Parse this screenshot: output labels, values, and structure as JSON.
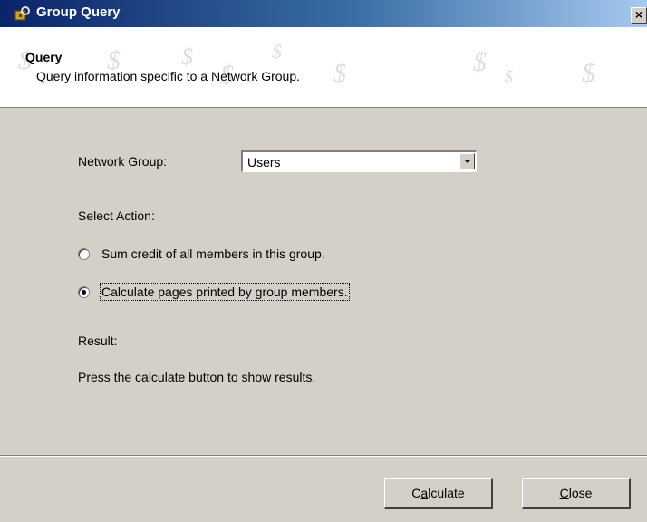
{
  "window": {
    "title": "Group Query",
    "close_label": "×"
  },
  "banner": {
    "title": "Query",
    "subtitle": "Query information specific to a Network Group."
  },
  "form": {
    "network_group_label": "Network Group:",
    "network_group_value": "Users",
    "select_action_label": "Select Action:",
    "options": [
      {
        "label": "Sum credit of all members in this group.",
        "selected": false
      },
      {
        "label": "Calculate pages printed by group members.",
        "selected": true
      }
    ],
    "result_label": "Result:",
    "result_text": "Press the calculate button to show results."
  },
  "buttons": {
    "calculate_pre": "C",
    "calculate_acc": "a",
    "calculate_post": "lculate",
    "close_pre": "",
    "close_acc": "C",
    "close_post": "lose"
  }
}
